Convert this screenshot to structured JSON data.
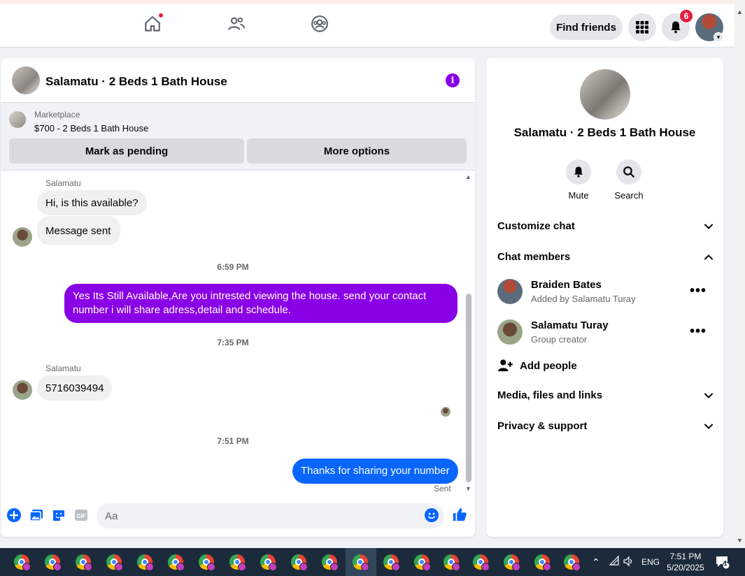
{
  "header": {
    "find_friends": "Find friends",
    "notification_count": "6"
  },
  "chat": {
    "title": "Salamatu · 2 Beds 1 Bath House",
    "marketplace_label": "Marketplace",
    "listing": "$700 - 2 Beds 1 Bath House",
    "mark_pending": "Mark as pending",
    "more_options": "More options",
    "messages": [
      {
        "sender": "Salamatu",
        "text": "Hi, is this available?"
      },
      {
        "text": "Message sent"
      },
      {
        "time": "6:59 PM"
      },
      {
        "text": "Yes Its Still Available,Are you intrested viewing the house. send your contact number i will share adress,detail and schedule."
      },
      {
        "time": "7:35 PM"
      },
      {
        "sender": "Salamatu",
        "text": "5716039494"
      },
      {
        "time": "7:51 PM"
      },
      {
        "text": "Thanks for sharing your number",
        "status": "Sent"
      }
    ],
    "composer_placeholder": "Aa",
    "purple": "#8a00e6",
    "blue": "#0866ff"
  },
  "info": {
    "title": "Salamatu · 2 Beds 1 Bath House",
    "mute": "Mute",
    "search": "Search",
    "customize": "Customize chat",
    "members_header": "Chat members",
    "members": [
      {
        "name": "Braiden Bates",
        "sub": "Added by Salamatu Turay"
      },
      {
        "name": "Salamatu Turay",
        "sub": "Group creator"
      }
    ],
    "add_people": "Add people",
    "media": "Media, files and links",
    "privacy": "Privacy & support"
  },
  "taskbar": {
    "language": "ENG",
    "time": "7:51 PM",
    "date": "5/20/2025",
    "notif": "1"
  }
}
